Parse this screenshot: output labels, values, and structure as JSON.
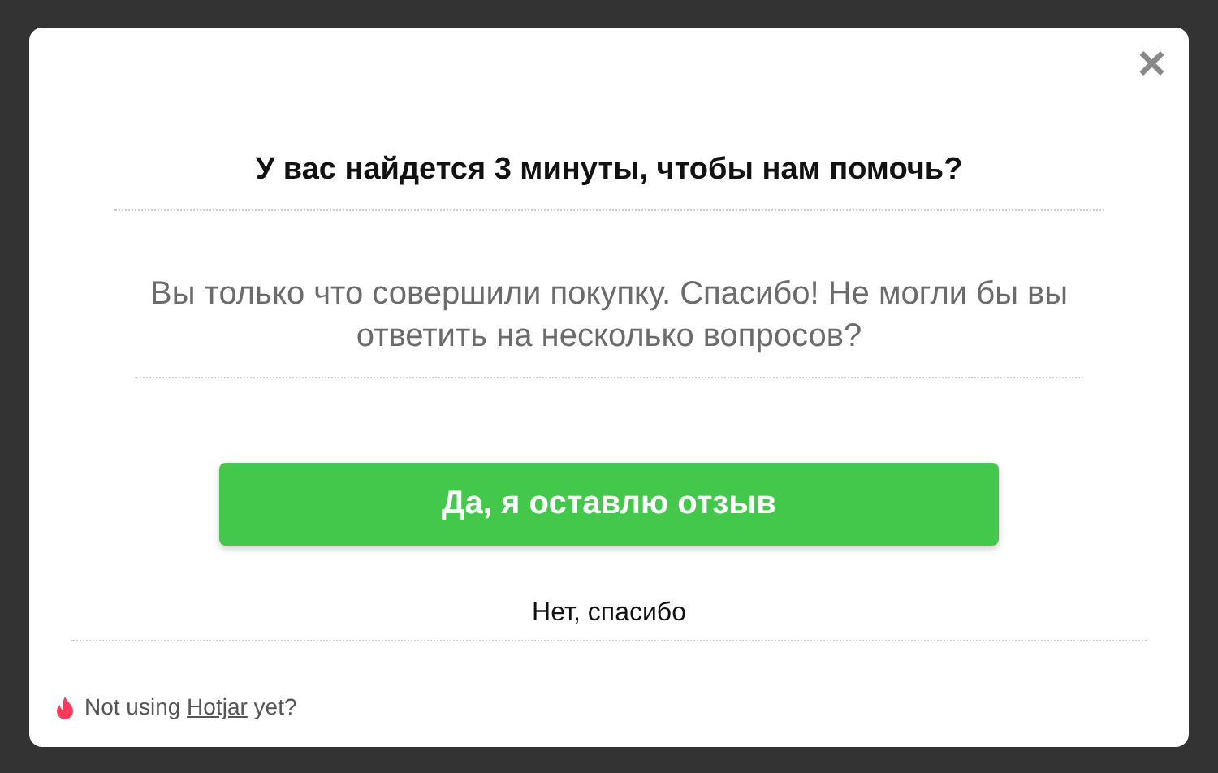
{
  "close": "×",
  "title": "У вас найдется 3 минуты, чтобы нам помочь?",
  "message": "Вы только что совершили покупку. Спасибо! Не могли бы вы ответить на несколько вопросов?",
  "buttons": [
    {
      "kind": "primary",
      "label": "Да, я оставлю отзыв"
    },
    {
      "kind": "link",
      "label": "Нет, спасибо"
    }
  ],
  "footer": {
    "before": "Not using",
    "link": "Hotjar",
    "after": "yet?"
  }
}
